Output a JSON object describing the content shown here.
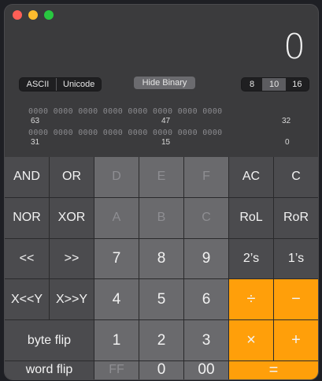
{
  "window": {
    "controls": [
      "close",
      "minimize",
      "zoom"
    ]
  },
  "display": {
    "value": "0"
  },
  "encoding": {
    "options": [
      "ASCII",
      "Unicode"
    ],
    "selected": ""
  },
  "binary_toggle": {
    "label": "Hide Binary"
  },
  "base": {
    "options": [
      "8",
      "10",
      "16"
    ],
    "selected": "10"
  },
  "bits": {
    "row1": "0000 0000 0000 0000 0000 0000 0000 0000",
    "row2": "0000 0000 0000 0000 0000 0000 0000 0000",
    "labels_row1": [
      "63",
      "47",
      "32"
    ],
    "labels_row2": [
      "31",
      "15",
      "0"
    ]
  },
  "keys": {
    "and": "AND",
    "or": "OR",
    "d": "D",
    "e": "E",
    "f": "F",
    "ac": "AC",
    "c": "C",
    "nor": "NOR",
    "xor": "XOR",
    "a": "A",
    "b": "B",
    "c_hex": "C",
    "rol": "RoL",
    "ror": "RoR",
    "shl": "<<",
    "shr": ">>",
    "7": "7",
    "8": "8",
    "9": "9",
    "twos": "2’s",
    "ones": "1’s",
    "xshl": "X<<Y",
    "xshr": "X>>Y",
    "4": "4",
    "5": "5",
    "6": "6",
    "div": "÷",
    "minus": "−",
    "byte_flip": "byte flip",
    "1": "1",
    "2": "2",
    "3": "3",
    "mul": "×",
    "plus": "+",
    "word_flip": "word flip",
    "ff": "FF",
    "0": "0",
    "00": "00",
    "eq": "="
  },
  "colors": {
    "operator": "#ff9f0a",
    "digit": "#6a6a6d",
    "function": "#4b4b4e"
  }
}
